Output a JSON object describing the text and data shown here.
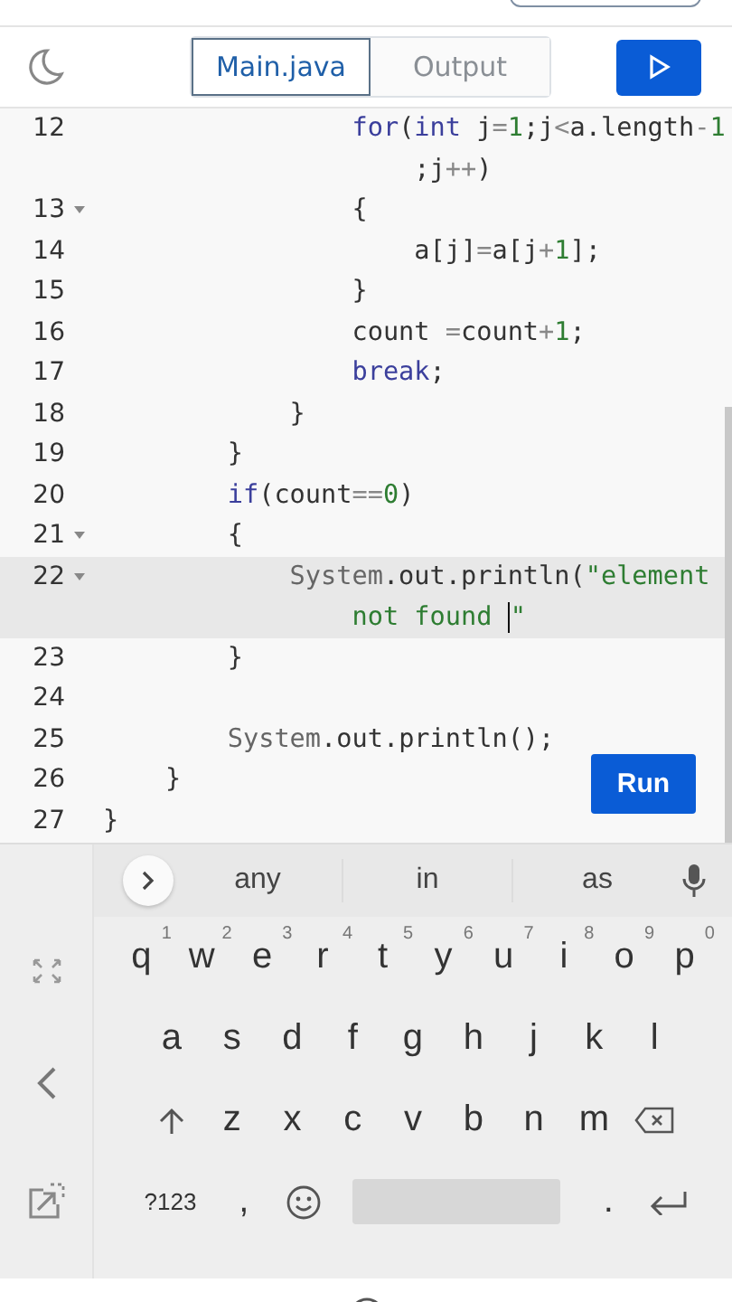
{
  "toolbar": {
    "tabs": [
      {
        "label": "Main.java",
        "selected": true
      },
      {
        "label": "Output",
        "selected": false
      }
    ]
  },
  "editor": {
    "lines": [
      {
        "number": "12",
        "fold": false,
        "current": false,
        "tokens": [
          {
            "kind": "kw",
            "text": "                for"
          },
          {
            "kind": "plain",
            "text": "("
          },
          {
            "kind": "kw",
            "text": "int"
          },
          {
            "kind": "plain",
            "text": " j"
          },
          {
            "kind": "op",
            "text": "="
          },
          {
            "kind": "num",
            "text": "1"
          },
          {
            "kind": "plain",
            "text": ";j"
          },
          {
            "kind": "op",
            "text": "<"
          },
          {
            "kind": "plain",
            "text": "a.length"
          },
          {
            "kind": "op",
            "text": "-"
          },
          {
            "kind": "num",
            "text": "1"
          }
        ]
      },
      {
        "fold": false,
        "current": false,
        "tokens": [
          {
            "kind": "plain",
            "text": "                    ;j"
          },
          {
            "kind": "op",
            "text": "++"
          },
          {
            "kind": "plain",
            "text": ")"
          }
        ]
      },
      {
        "number": "13",
        "fold": true,
        "current": false,
        "tokens": [
          {
            "kind": "plain",
            "text": "                {"
          }
        ]
      },
      {
        "number": "14",
        "fold": false,
        "current": false,
        "tokens": [
          {
            "kind": "plain",
            "text": "                    a[j]"
          },
          {
            "kind": "op",
            "text": "="
          },
          {
            "kind": "plain",
            "text": "a[j"
          },
          {
            "kind": "op",
            "text": "+"
          },
          {
            "kind": "num",
            "text": "1"
          },
          {
            "kind": "plain",
            "text": "];"
          }
        ]
      },
      {
        "number": "15",
        "fold": false,
        "current": false,
        "tokens": [
          {
            "kind": "plain",
            "text": "                }"
          }
        ]
      },
      {
        "number": "16",
        "fold": false,
        "current": false,
        "tokens": [
          {
            "kind": "plain",
            "text": "                count "
          },
          {
            "kind": "op",
            "text": "="
          },
          {
            "kind": "plain",
            "text": "count"
          },
          {
            "kind": "op",
            "text": "+"
          },
          {
            "kind": "num",
            "text": "1"
          },
          {
            "kind": "plain",
            "text": ";"
          }
        ]
      },
      {
        "number": "17",
        "fold": false,
        "current": false,
        "tokens": [
          {
            "kind": "kw",
            "text": "                break"
          },
          {
            "kind": "plain",
            "text": ";"
          }
        ]
      },
      {
        "number": "18",
        "fold": false,
        "current": false,
        "tokens": [
          {
            "kind": "plain",
            "text": "            }"
          }
        ]
      },
      {
        "number": "19",
        "fold": false,
        "current": false,
        "tokens": [
          {
            "kind": "plain",
            "text": "        }"
          }
        ]
      },
      {
        "number": "20",
        "fold": false,
        "current": false,
        "tokens": [
          {
            "kind": "kw",
            "text": "        if"
          },
          {
            "kind": "plain",
            "text": "(count"
          },
          {
            "kind": "op",
            "text": "=="
          },
          {
            "kind": "num",
            "text": "0"
          },
          {
            "kind": "plain",
            "text": ")"
          }
        ]
      },
      {
        "number": "21",
        "fold": true,
        "current": false,
        "tokens": [
          {
            "kind": "plain",
            "text": "        {"
          }
        ]
      },
      {
        "number": "22",
        "fold": true,
        "current": true,
        "tokens": [
          {
            "kind": "cls",
            "text": "            System"
          },
          {
            "kind": "plain",
            "text": ".out.println("
          },
          {
            "kind": "str",
            "text": "\"element"
          }
        ]
      },
      {
        "fold": false,
        "current": true,
        "tokens": [
          {
            "kind": "str",
            "text": "                not found "
          },
          {
            "kind": "caret"
          },
          {
            "kind": "str",
            "text": "\""
          }
        ]
      },
      {
        "number": "23",
        "fold": false,
        "current": false,
        "tokens": [
          {
            "kind": "plain",
            "text": "        }"
          }
        ]
      },
      {
        "number": "24",
        "fold": false,
        "current": false
      },
      {
        "number": "25",
        "fold": false,
        "current": false,
        "tokens": [
          {
            "kind": "cls",
            "text": "        System"
          },
          {
            "kind": "plain",
            "text": ".out.println();"
          }
        ]
      },
      {
        "number": "26",
        "fold": false,
        "current": false,
        "tokens": [
          {
            "kind": "plain",
            "text": "    }"
          }
        ]
      },
      {
        "number": "27",
        "fold": false,
        "current": false,
        "tokens": [
          {
            "kind": "plain",
            "text": "}"
          }
        ]
      }
    ]
  },
  "run_button": {
    "label": "Run"
  },
  "keyboard": {
    "suggestions": [
      "any",
      "in",
      "as"
    ],
    "rows": [
      [
        {
          "kind": "letter",
          "label": "q",
          "hint": "1"
        },
        {
          "kind": "letter",
          "label": "w",
          "hint": "2"
        },
        {
          "kind": "letter",
          "label": "e",
          "hint": "3"
        },
        {
          "kind": "letter",
          "label": "r",
          "hint": "4"
        },
        {
          "kind": "letter",
          "label": "t",
          "hint": "5"
        },
        {
          "kind": "letter",
          "label": "y",
          "hint": "6"
        },
        {
          "kind": "letter",
          "label": "u",
          "hint": "7"
        },
        {
          "kind": "letter",
          "label": "i",
          "hint": "8"
        },
        {
          "kind": "letter",
          "label": "o",
          "hint": "9"
        },
        {
          "kind": "letter",
          "label": "p",
          "hint": "0"
        }
      ],
      [
        {
          "kind": "letter",
          "label": "a"
        },
        {
          "kind": "letter",
          "label": "s"
        },
        {
          "kind": "letter",
          "label": "d"
        },
        {
          "kind": "letter",
          "label": "f"
        },
        {
          "kind": "letter",
          "label": "g"
        },
        {
          "kind": "letter",
          "label": "h"
        },
        {
          "kind": "letter",
          "label": "j"
        },
        {
          "kind": "letter",
          "label": "k"
        },
        {
          "kind": "letter",
          "label": "l"
        }
      ],
      [
        {
          "kind": "shift"
        },
        {
          "kind": "letter",
          "label": "z"
        },
        {
          "kind": "letter",
          "label": "x"
        },
        {
          "kind": "letter",
          "label": "c"
        },
        {
          "kind": "letter",
          "label": "v"
        },
        {
          "kind": "letter",
          "label": "b"
        },
        {
          "kind": "letter",
          "label": "n"
        },
        {
          "kind": "letter",
          "label": "m"
        },
        {
          "kind": "backspace"
        }
      ],
      [
        {
          "kind": "symbols",
          "label": "?123"
        },
        {
          "kind": "letter",
          "label": ","
        },
        {
          "kind": "emoji"
        },
        {
          "kind": "space"
        },
        {
          "kind": "letter",
          "label": "."
        },
        {
          "kind": "enter"
        }
      ]
    ]
  }
}
